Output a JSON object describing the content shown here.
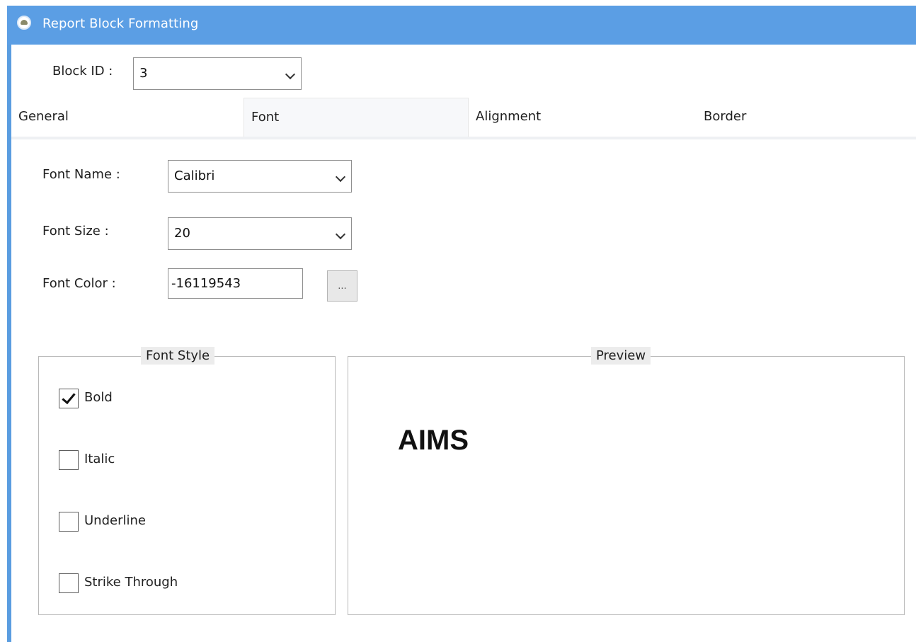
{
  "window": {
    "title": "Report Block Formatting"
  },
  "block": {
    "label": "Block ID :",
    "value": "3"
  },
  "tabs": [
    {
      "label": "General",
      "active": false
    },
    {
      "label": "Font",
      "active": true
    },
    {
      "label": "Alignment",
      "active": false
    },
    {
      "label": "Border",
      "active": false
    }
  ],
  "font": {
    "name_label": "Font Name :",
    "name_value": "Calibri",
    "size_label": "Font Size :",
    "size_value": "20",
    "color_label": "Font Color :",
    "color_value": "-16119543",
    "color_button_label": "..."
  },
  "font_style": {
    "title": "Font Style",
    "options": [
      {
        "label": "Bold",
        "checked": true
      },
      {
        "label": "Italic",
        "checked": false
      },
      {
        "label": "Underline",
        "checked": false
      },
      {
        "label": "Strike Through",
        "checked": false
      }
    ]
  },
  "preview": {
    "title": "Preview",
    "text": "AIMS"
  }
}
